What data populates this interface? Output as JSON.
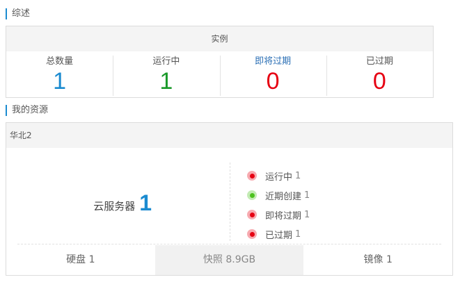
{
  "overview": {
    "title": "综述",
    "header": "实例",
    "stats": [
      {
        "label": "总数量",
        "value": "1",
        "color": "#1b8bd0"
      },
      {
        "label": "运行中",
        "value": "1",
        "color": "#1a9a2a"
      },
      {
        "label": "即将过期",
        "value": "0",
        "color": "#e60012"
      },
      {
        "label": "已过期",
        "value": "0",
        "color": "#e60012"
      }
    ]
  },
  "resources": {
    "title": "我的资源",
    "region": "华北2",
    "server": {
      "name": "云服务器",
      "count": "1"
    },
    "statuses": [
      {
        "label": "运行中",
        "count": "1",
        "color": "#e60012"
      },
      {
        "label": "近期创建",
        "count": "1",
        "color": "#4cc21e"
      },
      {
        "label": "即将过期",
        "count": "1",
        "color": "#e60012"
      },
      {
        "label": "已过期",
        "count": "1",
        "color": "#e60012"
      }
    ],
    "tabs": [
      {
        "label": "硬盘 1"
      },
      {
        "label": "快照 8.9GB"
      },
      {
        "label": "镜像 1"
      }
    ]
  }
}
